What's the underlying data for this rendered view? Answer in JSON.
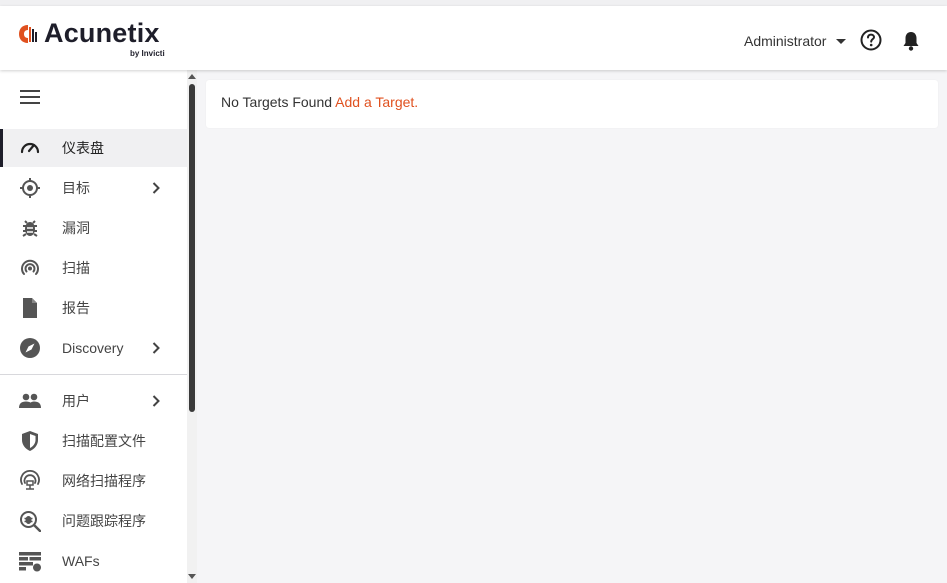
{
  "header": {
    "logo_text": "Acunetix",
    "logo_sub": "by Invicti",
    "user_name": "Administrator",
    "icons": [
      "help-icon",
      "bell-icon"
    ]
  },
  "sidebar": {
    "items": [
      {
        "label": "仪表盘",
        "icon": "dashboard-gauge-icon",
        "active": true
      },
      {
        "label": "目标",
        "icon": "crosshair-icon",
        "expandable": true
      },
      {
        "label": "漏洞",
        "icon": "bug-icon"
      },
      {
        "label": "扫描",
        "icon": "scan-radar-icon"
      },
      {
        "label": "报告",
        "icon": "document-icon"
      },
      {
        "label": "Discovery",
        "icon": "compass-icon",
        "expandable": true
      },
      {
        "label": "用户",
        "icon": "users-icon",
        "expandable": true
      },
      {
        "label": "扫描配置文件",
        "icon": "shield-icon"
      },
      {
        "label": "网络扫描程序",
        "icon": "network-scanner-icon"
      },
      {
        "label": "问题跟踪程序",
        "icon": "issue-tracker-icon"
      },
      {
        "label": "WAFs",
        "icon": "firewall-icon"
      }
    ]
  },
  "main": {
    "empty_message": "No Targets Found",
    "add_link": "Add a Target."
  },
  "colors": {
    "accent": "#e0511f",
    "brand_dark": "#1e1e2a",
    "background": "#f5f5f7"
  }
}
